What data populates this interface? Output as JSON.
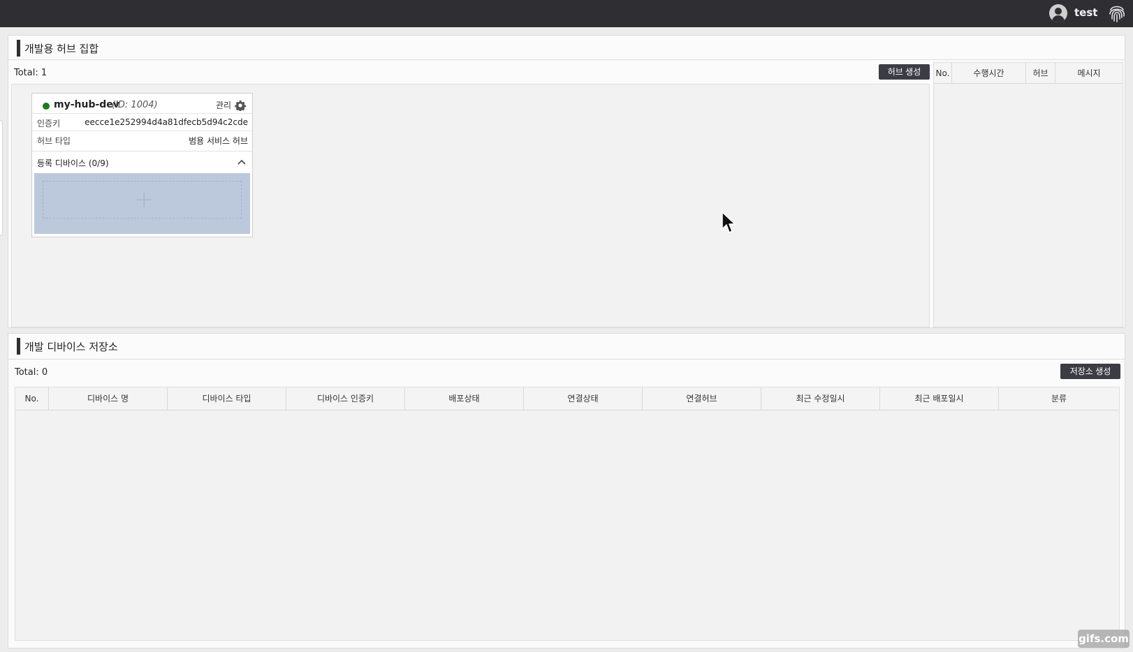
{
  "header": {
    "username": "test",
    "user_icon": "user-circle-icon",
    "fingerprint_icon": "fingerprint-icon"
  },
  "hub_section": {
    "title": "개발용 허브 집합",
    "total": "Total: 1",
    "create_button": "허브 생성",
    "log_columns": [
      "No.",
      "수행시간",
      "허브",
      "메시지"
    ],
    "hub": {
      "status": "online",
      "status_color": "#1e7a1e",
      "name": "my-hub-dev",
      "id": "(ID: 1004)",
      "manage_label": "관리",
      "auth_key_label": "인증키",
      "auth_key": "eecce1e252994d4a81dfecb5d94c2cde",
      "hub_type_label": "허브 타입",
      "hub_type": "범용 서비스 허브",
      "devices_label": "등록 디바이스 (0/9)"
    }
  },
  "device_section": {
    "title": "개발 디바이스 저장소",
    "total": "Total: 0",
    "create_button": "저장소 생성",
    "columns": [
      "No.",
      "디바이스 명",
      "디바이스 타입",
      "디바이스 인증키",
      "배포상태",
      "연결상태",
      "연결허브",
      "최근 수정일시",
      "최근 배포일시",
      "분류"
    ]
  },
  "watermark": "gifs.com"
}
